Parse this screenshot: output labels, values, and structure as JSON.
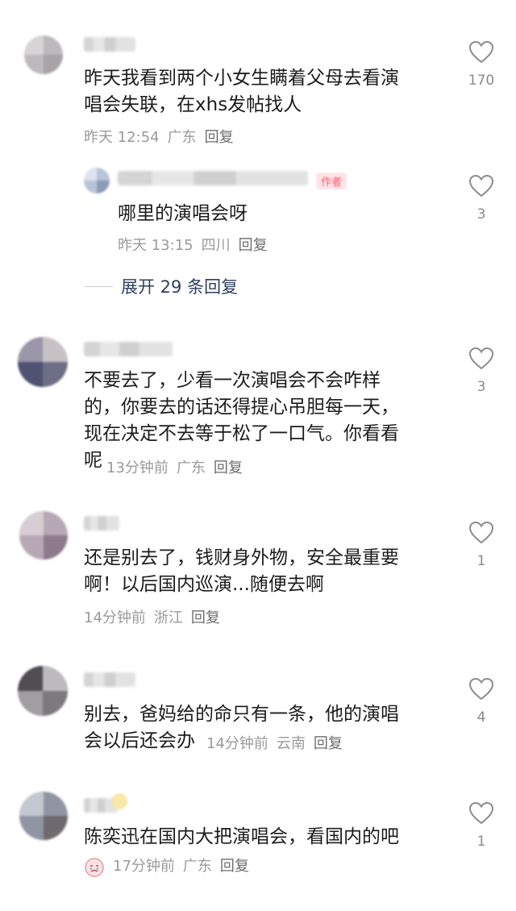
{
  "comments": [
    {
      "text": "昨天我看到两个小女生瞒着父母去看演\n唱会失联，在xhs发帖找人",
      "time": "昨天 12:54",
      "location": "广东",
      "reply": "回复",
      "likes": "170",
      "replies": [
        {
          "badge": "作者",
          "text": "哪里的演唱会呀",
          "time": "昨天 13:15",
          "location": "四川",
          "reply": "回复",
          "likes": "3"
        }
      ],
      "expand_label": "展开 29 条回复"
    },
    {
      "text": "不要去了，少看一次演唱会不会咋样\n的，你要去的话还得提心吊胆每一天，\n现在决定不去等于松了一口气。你看看\n呢",
      "time": "13分钟前",
      "location": "广东",
      "reply": "回复",
      "likes": "3"
    },
    {
      "text": "还是别去了，钱财身外物，安全最重要\n啊！以后国内巡演...随便去啊",
      "time": "14分钟前",
      "location": "浙江",
      "reply": "回复",
      "likes": "1"
    },
    {
      "text": "别去，爸妈给的命只有一条，他的演唱\n会以后还会办",
      "time": "14分钟前",
      "location": "云南",
      "reply": "回复",
      "likes": "4"
    },
    {
      "text": "陈奕迅在国内大把演唱会，看国内的吧",
      "time": "17分钟前",
      "location": "广东",
      "reply": "回复",
      "likes": "1",
      "sticker_icon": "crying-face-sticker-icon"
    }
  ],
  "icons": {
    "like": "heart-outline-icon"
  },
  "colors": {
    "like_stroke": "#8c8c8c",
    "meta_text": "#9a9a9a",
    "expand_text": "#2e3e5c"
  }
}
